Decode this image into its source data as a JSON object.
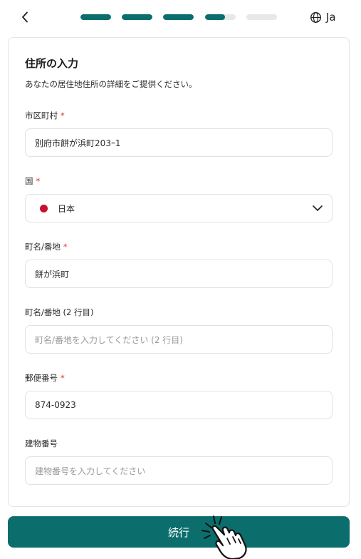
{
  "header": {
    "back_icon": "chevron-left-icon",
    "progress": {
      "total_steps": 5,
      "completed_steps": 3,
      "current_step_fraction": 0.65
    },
    "language": {
      "icon": "globe-icon",
      "label": "Ja"
    }
  },
  "form": {
    "title": "住所の入力",
    "subtitle": "あなたの居住地住所の詳細をご提供ください。",
    "required_marker": "*",
    "fields": {
      "city": {
        "label": "市区町村",
        "value": "別府市餅が浜町203ｰ1"
      },
      "country": {
        "label": "国",
        "value": "日本",
        "flag_color": "#c8102e"
      },
      "street": {
        "label": "町名/番地",
        "value": "餅が浜町"
      },
      "street2": {
        "label": "町名/番地",
        "label_suffix": "(2 行目)",
        "placeholder": "町名/番地を入力してください (2 行目)"
      },
      "postal": {
        "label": "郵便番号",
        "value": "874-0923"
      },
      "building": {
        "label": "建物番号",
        "placeholder": "建物番号を入力してください"
      }
    }
  },
  "continue_label": "続行",
  "colors": {
    "accent": "#0b6e6c",
    "required": "#d9352b",
    "track": "#e8e8e8"
  }
}
